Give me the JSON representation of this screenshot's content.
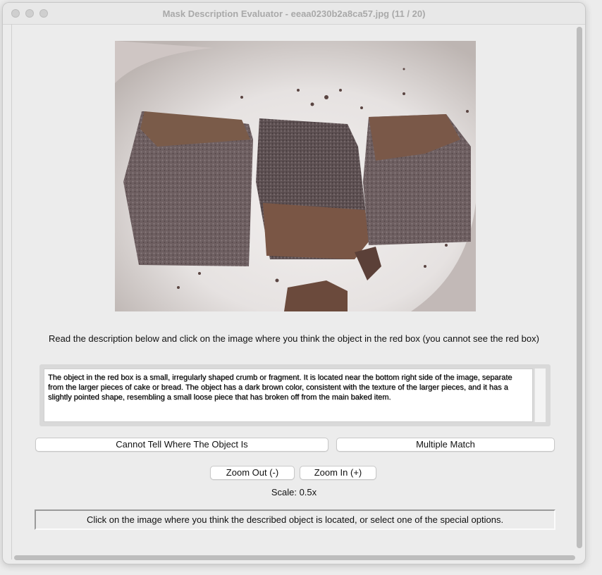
{
  "window": {
    "title": "Mask Description Evaluator - eeaa0230b2a8ca57.jpg (11 / 20)"
  },
  "main": {
    "instruction": "Read the description below and click on the image where you think the object in the red box (you cannot see the red box)",
    "description": "The object in the red box is a small, irregularly shaped crumb or fragment. It is located near the bottom right side of the image, separate from the larger pieces of cake or bread. The object has a dark brown color, consistent with the texture of the larger pieces, and it has a slightly pointed shape, resembling a small loose piece that has broken off from the main baked item.",
    "buttons": {
      "cannot_tell": "Cannot Tell Where The Object Is",
      "multiple_match": "Multiple Match",
      "zoom_out": "Zoom Out (-)",
      "zoom_in": "Zoom In (+)"
    },
    "scale": "Scale: 0.5x",
    "status": "Click on the image where you think the described object is located, or select one of the special options."
  },
  "colors": {
    "window_bg": "#ececec",
    "button_bg": "#ffffff",
    "title_text": "#a9a9a9"
  }
}
